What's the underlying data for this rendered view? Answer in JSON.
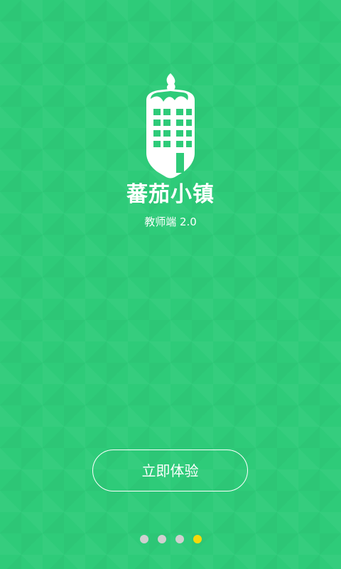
{
  "app": {
    "name": "蕃茄小镇",
    "subtitle": "教师端 2.0",
    "logo_icon": "tomato-building-icon"
  },
  "actions": {
    "start_label": "立即体验"
  },
  "pager": {
    "dots": [
      {
        "active": false
      },
      {
        "active": false
      },
      {
        "active": false
      },
      {
        "active": true
      }
    ],
    "current_page": 4,
    "total_pages": 4
  },
  "colors": {
    "background": "#2ecb79",
    "text": "#ffffff",
    "dot_inactive": "#d0d0d0",
    "dot_active": "#f5d90a"
  }
}
